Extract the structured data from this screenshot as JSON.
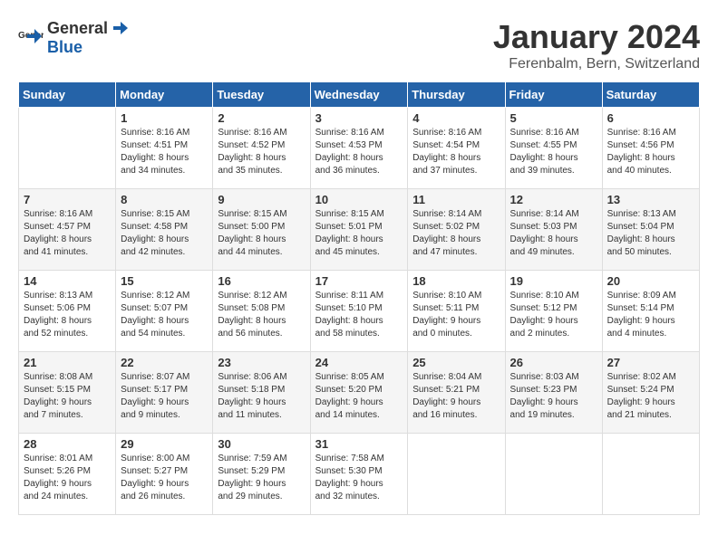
{
  "logo": {
    "text_general": "General",
    "text_blue": "Blue"
  },
  "title": "January 2024",
  "location": "Ferenbalm, Bern, Switzerland",
  "days_of_week": [
    "Sunday",
    "Monday",
    "Tuesday",
    "Wednesday",
    "Thursday",
    "Friday",
    "Saturday"
  ],
  "weeks": [
    [
      {
        "day": "",
        "info": ""
      },
      {
        "day": "1",
        "info": "Sunrise: 8:16 AM\nSunset: 4:51 PM\nDaylight: 8 hours\nand 34 minutes."
      },
      {
        "day": "2",
        "info": "Sunrise: 8:16 AM\nSunset: 4:52 PM\nDaylight: 8 hours\nand 35 minutes."
      },
      {
        "day": "3",
        "info": "Sunrise: 8:16 AM\nSunset: 4:53 PM\nDaylight: 8 hours\nand 36 minutes."
      },
      {
        "day": "4",
        "info": "Sunrise: 8:16 AM\nSunset: 4:54 PM\nDaylight: 8 hours\nand 37 minutes."
      },
      {
        "day": "5",
        "info": "Sunrise: 8:16 AM\nSunset: 4:55 PM\nDaylight: 8 hours\nand 39 minutes."
      },
      {
        "day": "6",
        "info": "Sunrise: 8:16 AM\nSunset: 4:56 PM\nDaylight: 8 hours\nand 40 minutes."
      }
    ],
    [
      {
        "day": "7",
        "info": "Sunrise: 8:16 AM\nSunset: 4:57 PM\nDaylight: 8 hours\nand 41 minutes."
      },
      {
        "day": "8",
        "info": "Sunrise: 8:15 AM\nSunset: 4:58 PM\nDaylight: 8 hours\nand 42 minutes."
      },
      {
        "day": "9",
        "info": "Sunrise: 8:15 AM\nSunset: 5:00 PM\nDaylight: 8 hours\nand 44 minutes."
      },
      {
        "day": "10",
        "info": "Sunrise: 8:15 AM\nSunset: 5:01 PM\nDaylight: 8 hours\nand 45 minutes."
      },
      {
        "day": "11",
        "info": "Sunrise: 8:14 AM\nSunset: 5:02 PM\nDaylight: 8 hours\nand 47 minutes."
      },
      {
        "day": "12",
        "info": "Sunrise: 8:14 AM\nSunset: 5:03 PM\nDaylight: 8 hours\nand 49 minutes."
      },
      {
        "day": "13",
        "info": "Sunrise: 8:13 AM\nSunset: 5:04 PM\nDaylight: 8 hours\nand 50 minutes."
      }
    ],
    [
      {
        "day": "14",
        "info": "Sunrise: 8:13 AM\nSunset: 5:06 PM\nDaylight: 8 hours\nand 52 minutes."
      },
      {
        "day": "15",
        "info": "Sunrise: 8:12 AM\nSunset: 5:07 PM\nDaylight: 8 hours\nand 54 minutes."
      },
      {
        "day": "16",
        "info": "Sunrise: 8:12 AM\nSunset: 5:08 PM\nDaylight: 8 hours\nand 56 minutes."
      },
      {
        "day": "17",
        "info": "Sunrise: 8:11 AM\nSunset: 5:10 PM\nDaylight: 8 hours\nand 58 minutes."
      },
      {
        "day": "18",
        "info": "Sunrise: 8:10 AM\nSunset: 5:11 PM\nDaylight: 9 hours\nand 0 minutes."
      },
      {
        "day": "19",
        "info": "Sunrise: 8:10 AM\nSunset: 5:12 PM\nDaylight: 9 hours\nand 2 minutes."
      },
      {
        "day": "20",
        "info": "Sunrise: 8:09 AM\nSunset: 5:14 PM\nDaylight: 9 hours\nand 4 minutes."
      }
    ],
    [
      {
        "day": "21",
        "info": "Sunrise: 8:08 AM\nSunset: 5:15 PM\nDaylight: 9 hours\nand 7 minutes."
      },
      {
        "day": "22",
        "info": "Sunrise: 8:07 AM\nSunset: 5:17 PM\nDaylight: 9 hours\nand 9 minutes."
      },
      {
        "day": "23",
        "info": "Sunrise: 8:06 AM\nSunset: 5:18 PM\nDaylight: 9 hours\nand 11 minutes."
      },
      {
        "day": "24",
        "info": "Sunrise: 8:05 AM\nSunset: 5:20 PM\nDaylight: 9 hours\nand 14 minutes."
      },
      {
        "day": "25",
        "info": "Sunrise: 8:04 AM\nSunset: 5:21 PM\nDaylight: 9 hours\nand 16 minutes."
      },
      {
        "day": "26",
        "info": "Sunrise: 8:03 AM\nSunset: 5:23 PM\nDaylight: 9 hours\nand 19 minutes."
      },
      {
        "day": "27",
        "info": "Sunrise: 8:02 AM\nSunset: 5:24 PM\nDaylight: 9 hours\nand 21 minutes."
      }
    ],
    [
      {
        "day": "28",
        "info": "Sunrise: 8:01 AM\nSunset: 5:26 PM\nDaylight: 9 hours\nand 24 minutes."
      },
      {
        "day": "29",
        "info": "Sunrise: 8:00 AM\nSunset: 5:27 PM\nDaylight: 9 hours\nand 26 minutes."
      },
      {
        "day": "30",
        "info": "Sunrise: 7:59 AM\nSunset: 5:29 PM\nDaylight: 9 hours\nand 29 minutes."
      },
      {
        "day": "31",
        "info": "Sunrise: 7:58 AM\nSunset: 5:30 PM\nDaylight: 9 hours\nand 32 minutes."
      },
      {
        "day": "",
        "info": ""
      },
      {
        "day": "",
        "info": ""
      },
      {
        "day": "",
        "info": ""
      }
    ]
  ]
}
